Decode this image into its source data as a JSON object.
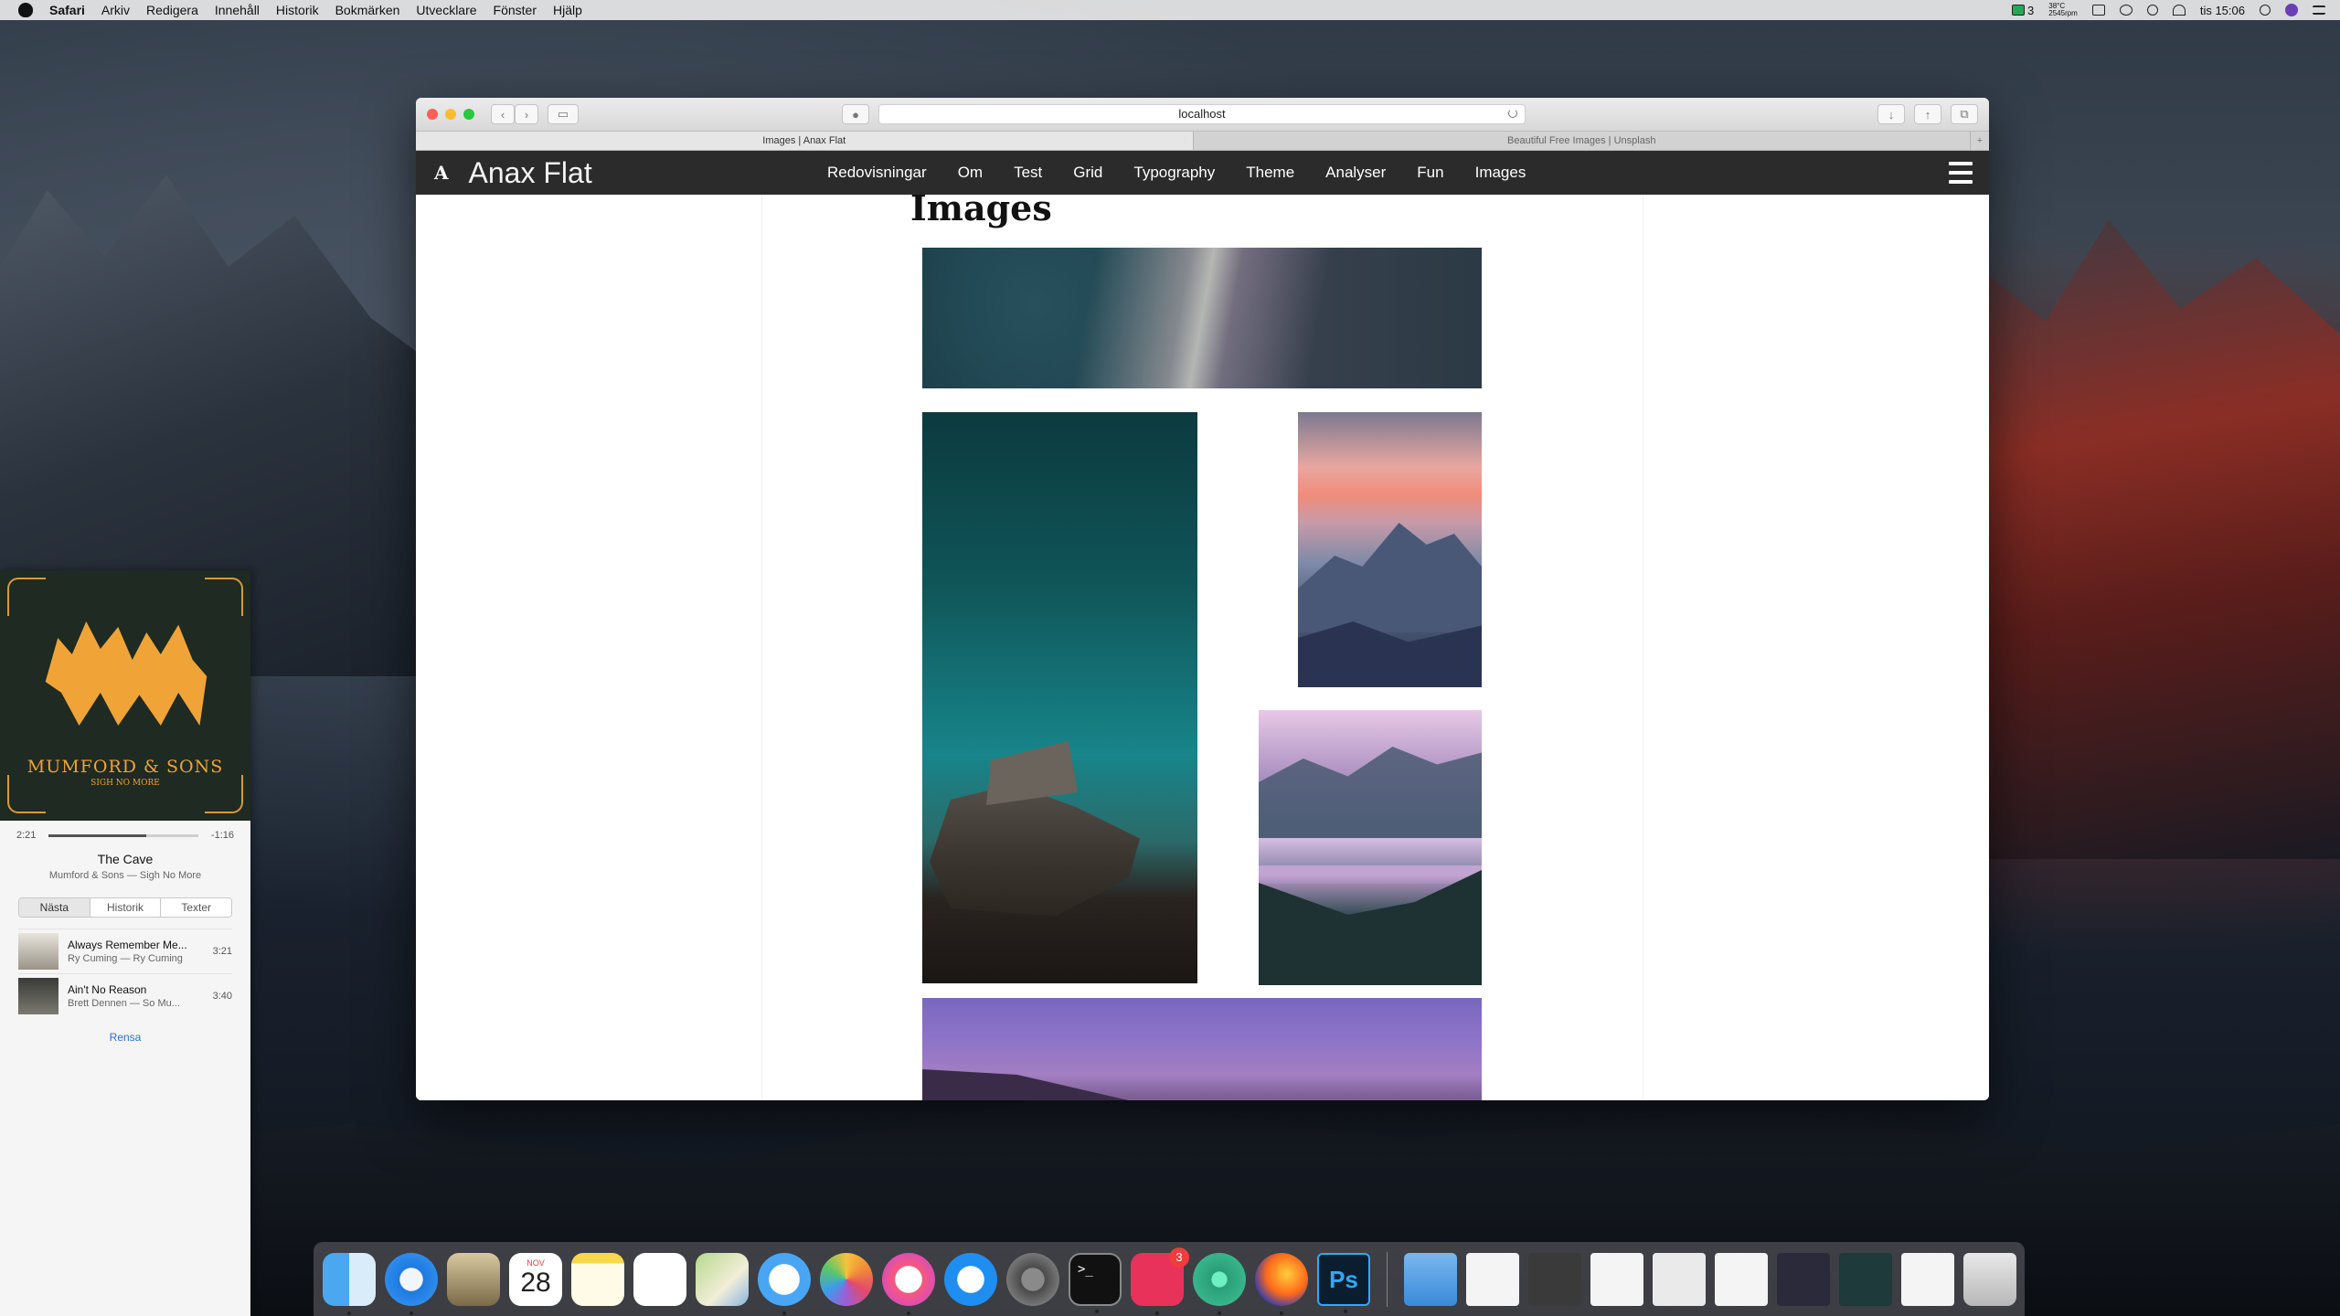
{
  "menubar": {
    "app": "Safari",
    "menus": [
      "Arkiv",
      "Redigera",
      "Innehåll",
      "Historik",
      "Bokmärken",
      "Utvecklare",
      "Fönster",
      "Hjälp"
    ],
    "status_count": "3",
    "temp": "38°C",
    "rpm": "2545rpm",
    "clock": "tis 15:06"
  },
  "browser": {
    "url": "localhost",
    "tabs": [
      {
        "title": "Images | Anax Flat",
        "active": true
      },
      {
        "title": "Beautiful Free Images | Unsplash",
        "active": false
      }
    ],
    "new_tab": "+"
  },
  "site": {
    "logo": "A",
    "title": "Anax Flat",
    "nav": [
      "Redovisningar",
      "Om",
      "Test",
      "Grid",
      "Typography",
      "Theme",
      "Analyser",
      "Fun",
      "Images"
    ],
    "page_heading": "Images"
  },
  "music": {
    "album_artist": "MUMFORD & SONS",
    "album_name": "SIGH NO MORE",
    "elapsed": "2:21",
    "remaining": "-1:16",
    "progress_fraction": 0.65,
    "track_title": "The Cave",
    "track_sub": "Mumford & Sons — Sigh No More",
    "segments": [
      "Nästa",
      "Historik",
      "Texter"
    ],
    "queue": [
      {
        "title": "Always Remember Me...",
        "artist": "Ry Cuming — Ry Cuming",
        "duration": "3:21"
      },
      {
        "title": "Ain't No Reason",
        "artist": "Brett Dennen — So Mu...",
        "duration": "3:40"
      }
    ],
    "clear": "Rensa"
  },
  "dock": {
    "calendar_month": "NOV",
    "calendar_day": "28",
    "badge_count": "3",
    "ps_label": "Ps",
    "terminal_prompt": ">_"
  }
}
